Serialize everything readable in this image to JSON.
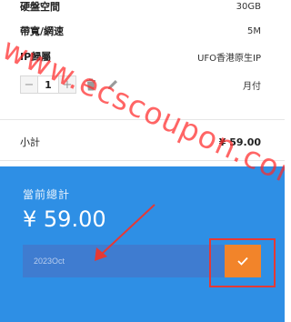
{
  "specs": [
    {
      "label": "硬盤空間",
      "value": "30GB"
    },
    {
      "label": "帶寬/網速",
      "value": "5M"
    },
    {
      "label": "IP歸屬",
      "value": "UFO香港原生IP"
    }
  ],
  "quantity": {
    "value": "1",
    "minus": "−",
    "plus": "+"
  },
  "billing_period": "月付",
  "subtotal": {
    "label": "小計",
    "price": "¥ 59.00"
  },
  "total": {
    "label": "當前總計",
    "amount": "¥ 59.00"
  },
  "promo": {
    "value": "2023Oct"
  },
  "watermark": "www.ecscoupon.com",
  "colors": {
    "panel": "#2e8fe5",
    "confirm": "#f2842a",
    "highlight": "#e53935"
  }
}
